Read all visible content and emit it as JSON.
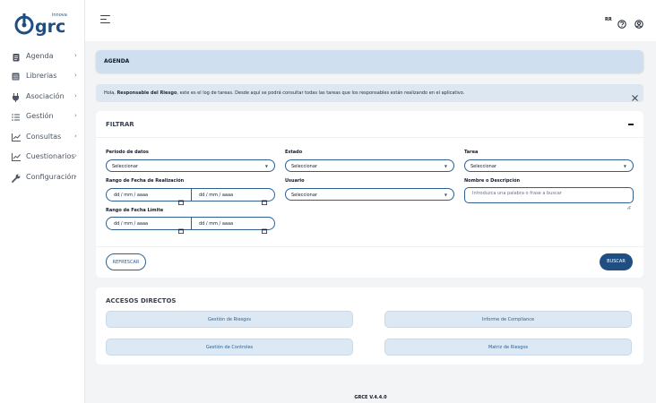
{
  "brand": {
    "wordmark": "grc",
    "tagline": "innova",
    "accent": "#1f4f82"
  },
  "sidebar": {
    "items": [
      {
        "label": "Agenda",
        "icon": "clipboard-icon"
      },
      {
        "label": "Librerias",
        "icon": "library-icon"
      },
      {
        "label": "Asociación",
        "icon": "plug-icon"
      },
      {
        "label": "Gestión",
        "icon": "list-icon"
      },
      {
        "label": "Consultas",
        "icon": "chart-icon"
      },
      {
        "label": "Cuestionarios",
        "icon": "chart-icon"
      },
      {
        "label": "Configuración",
        "icon": "wrench-icon"
      }
    ]
  },
  "header": {
    "user_initials": "RR",
    "help_icon": "help-circle-icon",
    "user_icon": "user-circle-icon"
  },
  "agenda": {
    "title": "AGENDA"
  },
  "info": {
    "prefix": "Hola, ",
    "role": "Responsable del Riesgo",
    "suffix": ", este es el log de tareas. Desde aquí se podrá consultar todas las tareas que los responsables están realizando en el aplicativo."
  },
  "filter": {
    "title": "FILTRAR",
    "periodo": {
      "label": "Periodo de datos",
      "value": "Seleccionar"
    },
    "estado": {
      "label": "Estado",
      "value": "Seleccionar"
    },
    "tarea": {
      "label": "Tarea",
      "value": "Seleccionar"
    },
    "rango_realizacion": {
      "label": "Rango de Fecha de Realización",
      "from": "dd / mm / aaaa",
      "to": "dd / mm / aaaa"
    },
    "usuario": {
      "label": "Usuario",
      "value": "Seleccionar"
    },
    "nombre": {
      "label": "Nombre o Descripción",
      "placeholder": "Introduzca una palabra o frase a buscar"
    },
    "rango_limite": {
      "label": "Rango de Fecha Límite",
      "from": "dd / mm / aaaa",
      "to": "dd / mm / aaaa"
    },
    "refresh_label": "REFRESCAR",
    "search_label": "BUSCAR"
  },
  "shortcuts": {
    "title": "ACCESOS DIRECTOS",
    "items": [
      "Gestión de Riesgos",
      "Informe de Compliance",
      "Gestión de Controles",
      "Matriz de Riesgos"
    ]
  },
  "footer": {
    "version": "GRCE V.4.4.0"
  }
}
